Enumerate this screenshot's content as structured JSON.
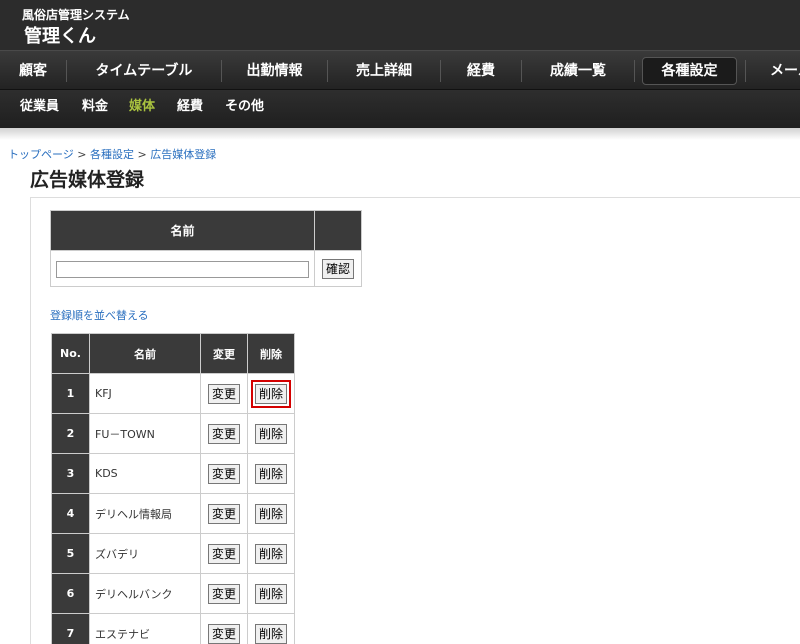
{
  "header": {
    "system_name": "風俗店管理システム",
    "app_name": "管理くん"
  },
  "main_nav": [
    {
      "label": "顧客",
      "active": false
    },
    {
      "label": "タイムテーブル",
      "active": false
    },
    {
      "label": "出勤情報",
      "active": false
    },
    {
      "label": "売上詳細",
      "active": false
    },
    {
      "label": "経費",
      "active": false
    },
    {
      "label": "成績一覧",
      "active": false
    },
    {
      "label": "各種設定",
      "active": true
    },
    {
      "label": "メール",
      "active": false
    }
  ],
  "sub_nav": [
    {
      "label": "従業員",
      "active": false
    },
    {
      "label": "料金",
      "active": false
    },
    {
      "label": "媒体",
      "active": true
    },
    {
      "label": "経費",
      "active": false
    },
    {
      "label": "その他",
      "active": false
    }
  ],
  "breadcrumb": {
    "items": [
      "トップページ",
      "各種設定",
      "広告媒体登録"
    ],
    "separator": ">"
  },
  "page_title": "広告媒体登録",
  "form": {
    "name_header": "名前",
    "name_value": "",
    "confirm_button": "確認"
  },
  "sort_link": "登録順を並べ替える",
  "media_table": {
    "headers": {
      "no": "No.",
      "name": "名前",
      "edit": "変更",
      "delete": "削除"
    },
    "edit_label": "変更",
    "delete_label": "削除",
    "highlighted_delete_row": 1,
    "rows": [
      {
        "no": "1",
        "name": "KFJ"
      },
      {
        "no": "2",
        "name": "FU－TOWN"
      },
      {
        "no": "3",
        "name": "KDS"
      },
      {
        "no": "4",
        "name": "デリヘル情報局"
      },
      {
        "no": "5",
        "name": "ズバデリ"
      },
      {
        "no": "6",
        "name": "デリヘルバンク"
      },
      {
        "no": "7",
        "name": "エステナビ"
      }
    ]
  }
}
